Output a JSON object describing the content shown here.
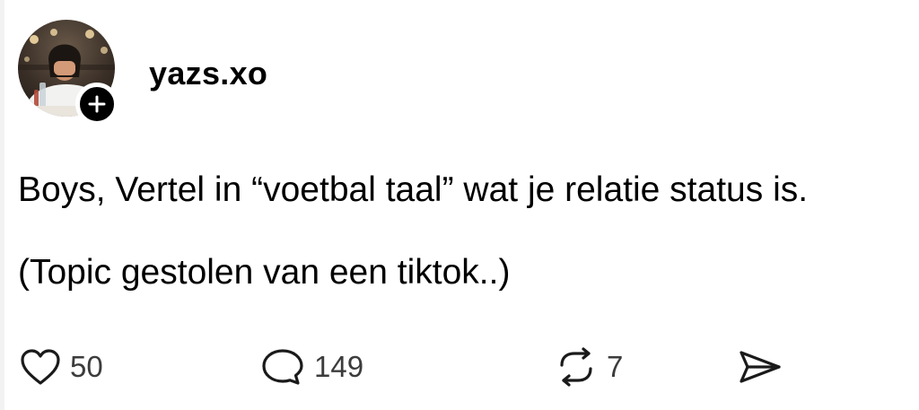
{
  "post": {
    "author": {
      "username": "yazs.xo",
      "avatar_icon": "profile-photo",
      "follow_icon": "plus-icon"
    },
    "text_lines": [
      "Boys, Vertel in “voetbal taal” wat je relatie status is.",
      "(Topic gestolen van een tiktok..)"
    ],
    "actions": {
      "likes": "50",
      "replies": "149",
      "reposts": "7",
      "like_icon": "heart-icon",
      "reply_icon": "speech-bubble-icon",
      "repost_icon": "repost-icon",
      "share_icon": "send-icon"
    }
  },
  "colors": {
    "text": "#000000",
    "count_text": "#3c3c3c",
    "badge": "#000000",
    "background": "#ffffff"
  }
}
